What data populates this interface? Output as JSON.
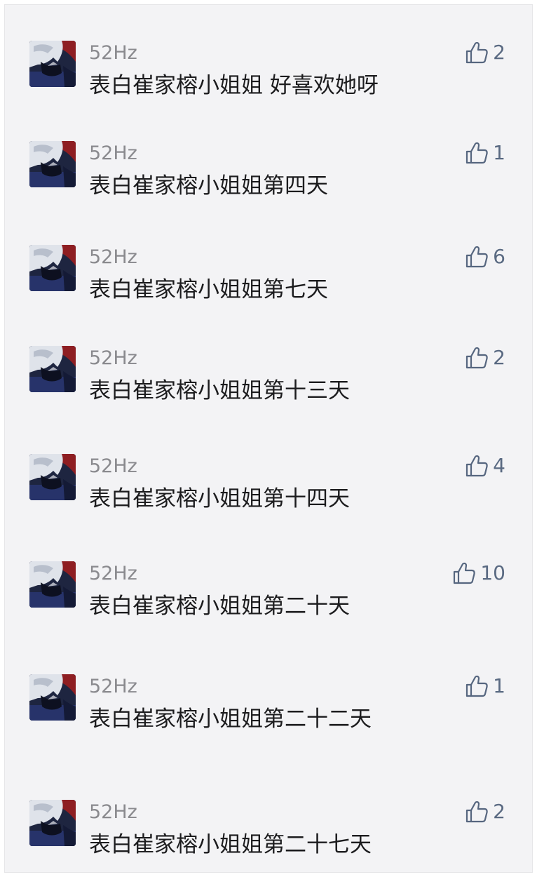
{
  "comments": [
    {
      "username": "52Hz",
      "text": "表白崔家榕小姐姐 好喜欢她呀",
      "likes": "2",
      "avatar_icon": "anime-avatar"
    },
    {
      "username": "52Hz",
      "text": "表白崔家榕小姐姐第四天",
      "likes": "1",
      "avatar_icon": "anime-avatar"
    },
    {
      "username": "52Hz",
      "text": "表白崔家榕小姐姐第七天",
      "likes": "6",
      "avatar_icon": "anime-avatar"
    },
    {
      "username": "52Hz",
      "text": "表白崔家榕小姐姐第十三天",
      "likes": "2",
      "avatar_icon": "anime-avatar"
    },
    {
      "username": "52Hz",
      "text": "表白崔家榕小姐姐第十四天",
      "likes": "4",
      "avatar_icon": "anime-avatar"
    },
    {
      "username": "52Hz",
      "text": "表白崔家榕小姐姐第二十天",
      "likes": "10",
      "avatar_icon": "anime-avatar"
    },
    {
      "username": "52Hz",
      "text": "表白崔家榕小姐姐第二十二天",
      "likes": "1",
      "avatar_icon": "anime-avatar"
    },
    {
      "username": "52Hz",
      "text": "表白崔家榕小姐姐第二十七天",
      "likes": "2",
      "avatar_icon": "anime-avatar"
    }
  ],
  "like_icon": "thumbs-up-icon",
  "colors": {
    "background": "#f3f3f5",
    "username": "#8a8a8e",
    "text": "#1c1c1e",
    "like": "#56667f"
  }
}
